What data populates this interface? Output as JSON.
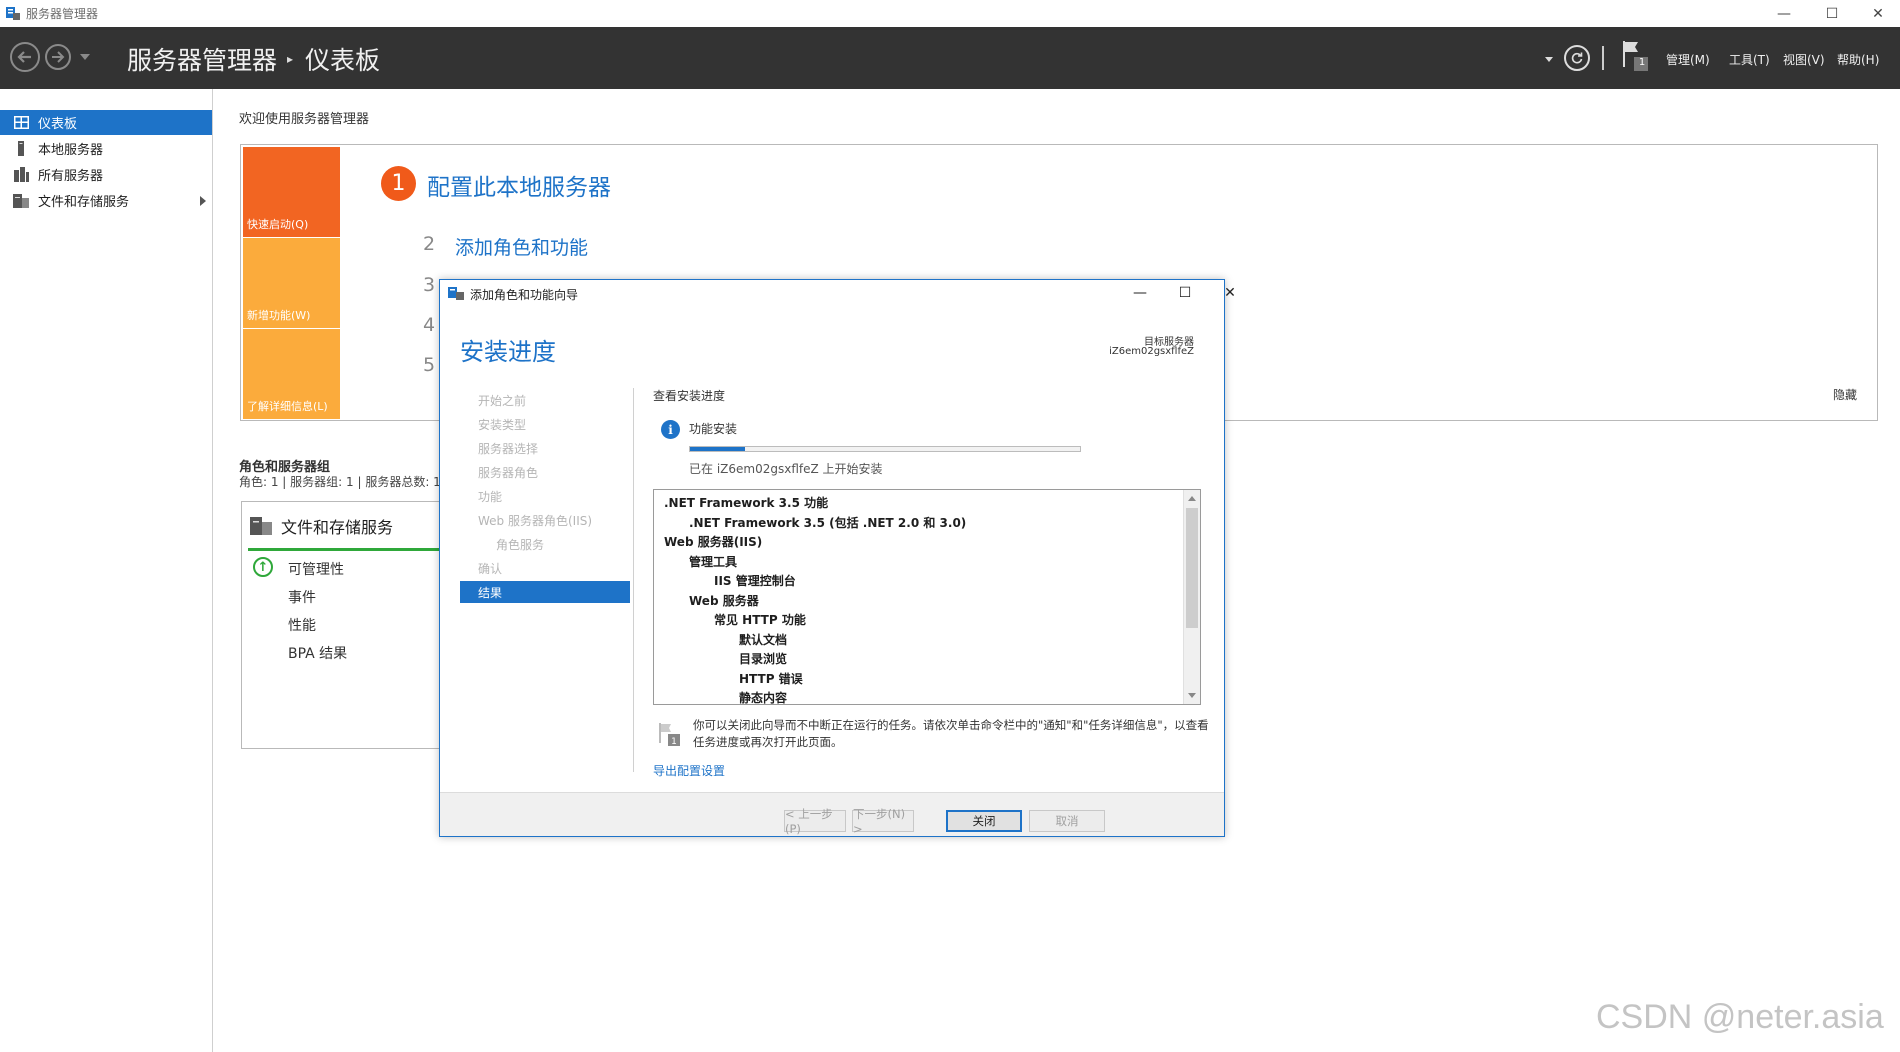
{
  "window": {
    "title": "服务器管理器",
    "controls": {
      "minimize": "—",
      "maximize": "☐",
      "close": "✕"
    }
  },
  "header": {
    "breadcrumb_root": "服务器管理器",
    "breadcrumb_sep": "▸",
    "breadcrumb_page": "仪表板",
    "flag_count": "1",
    "menus": [
      "管理(M)",
      "工具(T)",
      "视图(V)",
      "帮助(H)"
    ]
  },
  "sidebar": {
    "items": [
      {
        "label": "仪表板",
        "icon": "dashboard-icon",
        "active": true
      },
      {
        "label": "本地服务器",
        "icon": "server-icon"
      },
      {
        "label": "所有服务器",
        "icon": "servers-icon"
      },
      {
        "label": "文件和存储服务",
        "icon": "storage-icon",
        "expandable": true
      }
    ]
  },
  "dashboard": {
    "welcome": "欢迎使用服务器管理器",
    "tiles": [
      {
        "label": "快速启动(Q)",
        "color": "#f26522"
      },
      {
        "label": "新增功能(W)",
        "color": "#fbab3c"
      },
      {
        "label": "了解详细信息(L)",
        "color": "#fbab3c"
      }
    ],
    "steps": [
      {
        "num": "1",
        "label": "配置此本地服务器"
      },
      {
        "num": "2",
        "label": "添加角色和功能"
      },
      {
        "num": "3"
      },
      {
        "num": "4"
      },
      {
        "num": "5"
      }
    ],
    "hide": "隐藏",
    "roles_title": "角色和服务器组",
    "roles_sub": "角色: 1 | 服务器组: 1 | 服务器总数: 1",
    "role_card": {
      "title": "文件和存储服务",
      "rows": [
        "可管理性",
        "事件",
        "性能",
        "BPA 结果"
      ]
    }
  },
  "dialog": {
    "title": "添加角色和功能向导",
    "heading": "安装进度",
    "dest_label": "目标服务器",
    "dest_value": "iZ6em02gsxflfeZ",
    "steps": [
      "开始之前",
      "安装类型",
      "服务器选择",
      "服务器角色",
      "功能",
      "Web 服务器角色(IIS)",
      "角色服务",
      "确认",
      "结果"
    ],
    "view_progress": "查看安装进度",
    "feature_install": "功能安装",
    "progress": 0.14,
    "progress_text": "已在 iZ6em02gsxflfeZ 上开始安装",
    "features": [
      {
        "text": ".NET Framework 3.5 功能",
        "level": 0
      },
      {
        "text": ".NET Framework 3.5 (包括 .NET 2.0 和 3.0)",
        "level": 1
      },
      {
        "text": "Web 服务器(IIS)",
        "level": 0
      },
      {
        "text": "管理工具",
        "level": 1
      },
      {
        "text": "IIS 管理控制台",
        "level": 2
      },
      {
        "text": "Web 服务器",
        "level": 1
      },
      {
        "text": "常见 HTTP 功能",
        "level": 2
      },
      {
        "text": "默认文档",
        "level": 3
      },
      {
        "text": "目录浏览",
        "level": 3
      },
      {
        "text": "HTTP 错误",
        "level": 3
      },
      {
        "text": "静态内容",
        "level": 3
      }
    ],
    "note": "你可以关闭此向导而不中断正在运行的任务。请依次单击命令栏中的\"通知\"和\"任务详细信息\"，以查看任务进度或再次打开此页面。",
    "export_link": "导出配置设置",
    "buttons": {
      "prev": "< 上一步(P)",
      "next": "下一步(N) >",
      "close": "关闭",
      "cancel": "取消"
    }
  },
  "watermark": "CSDN @neter.asia"
}
